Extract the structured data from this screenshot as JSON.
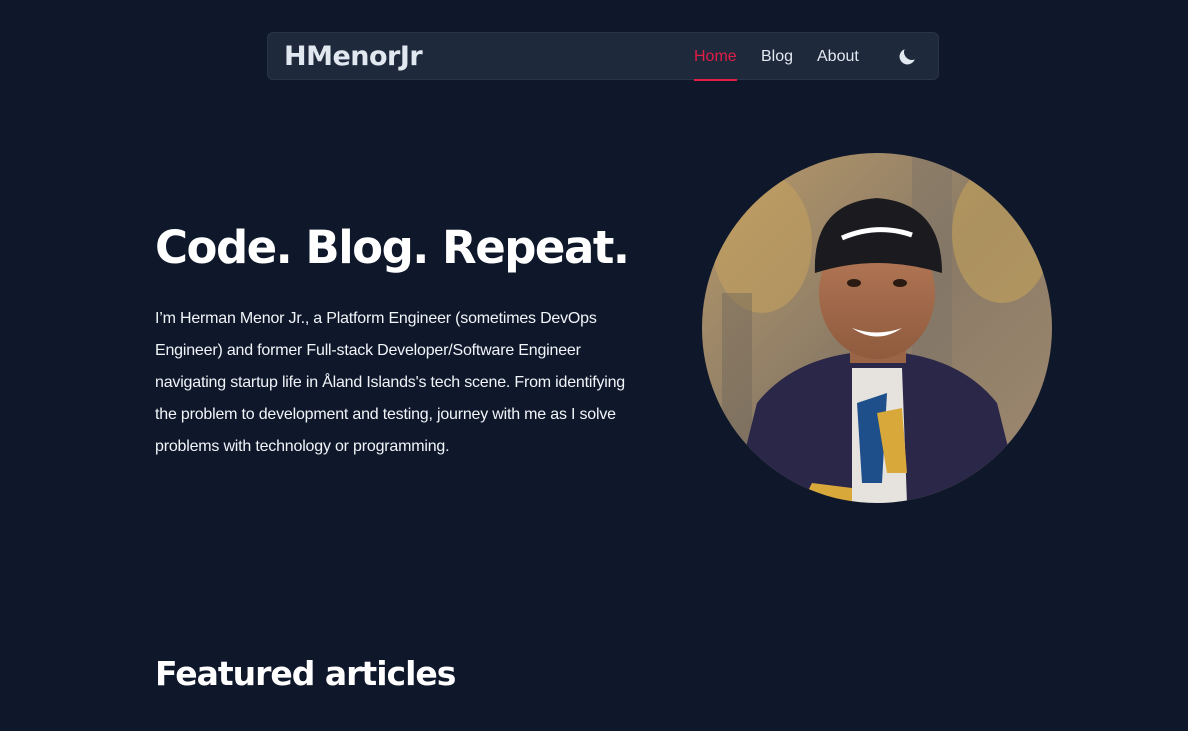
{
  "nav": {
    "brand": "HMenorJr",
    "links": [
      {
        "label": "Home",
        "active": true
      },
      {
        "label": "Blog",
        "active": false
      },
      {
        "label": "About",
        "active": false
      }
    ],
    "theme_icon": "moon-icon"
  },
  "hero": {
    "title": "Code. Blog. Repeat.",
    "intro": "I’m Herman Menor Jr., a Platform Engineer (sometimes DevOps Engineer) and former Full-stack Developer/Software Engineer navigating startup life in Åland Islands's tech scene. From identifying the problem to development and testing, journey with me as I solve problems with technology or programming.",
    "avatar_icon": "profile-photo"
  },
  "featured": {
    "title": "Featured articles"
  },
  "colors": {
    "background": "#0f172a",
    "navbar": "#1e293b",
    "accent": "#e11d48",
    "text": "#e2e8f0"
  }
}
